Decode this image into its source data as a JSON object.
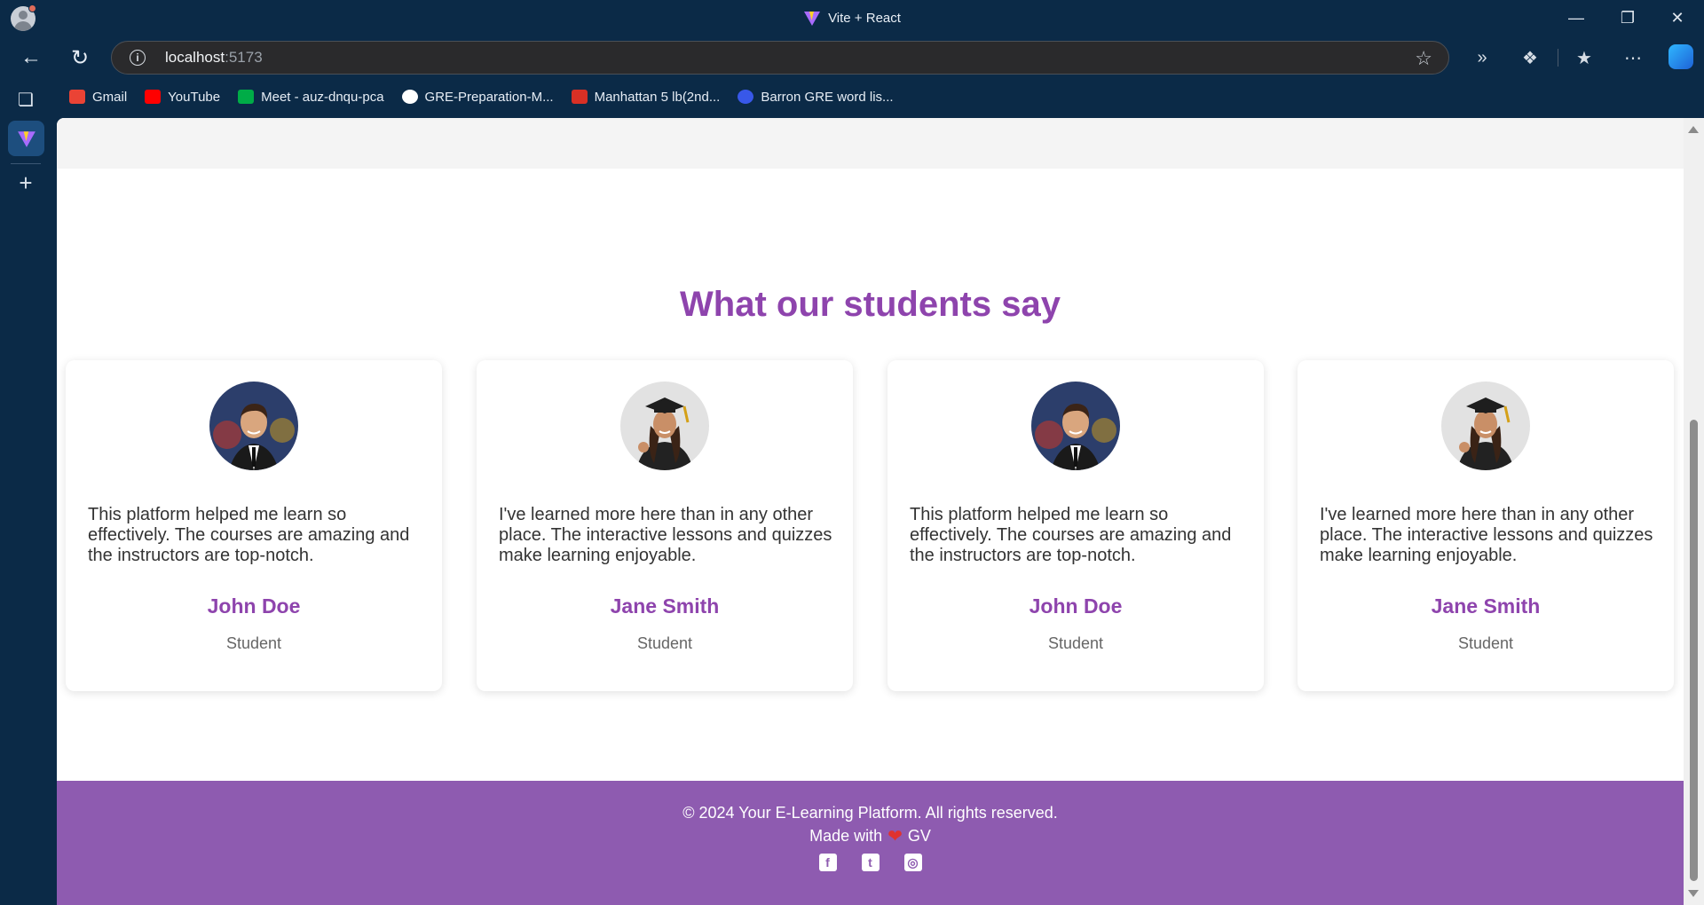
{
  "browser": {
    "window_title": "Vite + React",
    "url_host": "localhost",
    "url_port": ":5173",
    "bookmarks": [
      {
        "label": "Gmail",
        "icon": "gmail-icon",
        "color": "#ea4335"
      },
      {
        "label": "YouTube",
        "icon": "youtube-icon",
        "color": "#ff0000"
      },
      {
        "label": "Meet - auz-dnqu-pca",
        "icon": "meet-icon",
        "color": "#00ac47"
      },
      {
        "label": "GRE-Preparation-M...",
        "icon": "github-icon",
        "color": "#ffffff"
      },
      {
        "label": "Manhattan 5 lb(2nd...",
        "icon": "pdf-icon",
        "color": "#d93025"
      },
      {
        "label": "Barron GRE word lis...",
        "icon": "wordpress-icon",
        "color": "#3858e9"
      }
    ]
  },
  "page": {
    "section_title": "What our students say",
    "testimonials": [
      {
        "quote": "This platform helped me learn so effectively. The courses are amazing and the instructors are top-notch.",
        "name": "John Doe",
        "role": "Student",
        "avatar": "male-graduate-avatar"
      },
      {
        "quote": "I've learned more here than in any other place. The interactive lessons and quizzes make learning enjoyable.",
        "name": "Jane Smith",
        "role": "Student",
        "avatar": "female-graduate-avatar"
      },
      {
        "quote": "This platform helped me learn so effectively. The courses are amazing and the instructors are top-notch.",
        "name": "John Doe",
        "role": "Student",
        "avatar": "male-graduate-avatar"
      },
      {
        "quote": "I've learned more here than in any other place. The interactive lessons and quizzes make learning enjoyable.",
        "name": "Jane Smith",
        "role": "Student",
        "avatar": "female-graduate-avatar"
      }
    ],
    "footer": {
      "copyright": "© 2024 Your E-Learning Platform. All rights reserved.",
      "made_with_prefix": "Made with",
      "heart": "❤",
      "made_with_suffix": "GV",
      "socials": [
        "facebook-icon",
        "twitter-icon",
        "instagram-icon"
      ]
    }
  },
  "colors": {
    "accent": "#8e44ad",
    "footer_bg": "#8e5bb0",
    "browser_chrome": "#0b2a47"
  }
}
